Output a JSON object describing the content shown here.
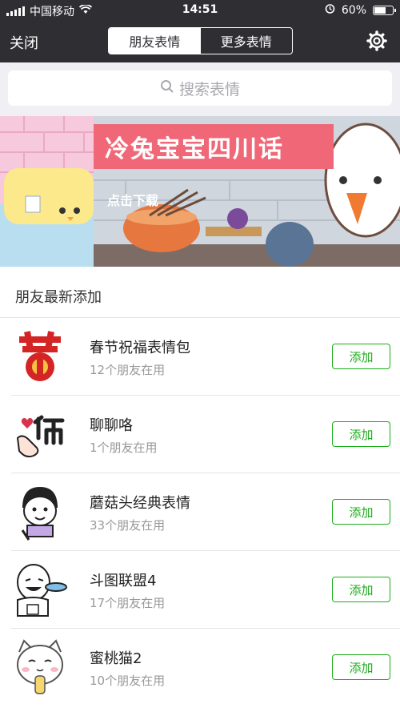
{
  "status_bar": {
    "carrier": "中国移动",
    "time": "14:51",
    "battery": "60%"
  },
  "nav": {
    "close_label": "关闭",
    "tabs": [
      {
        "label": "朋友表情",
        "active": true
      },
      {
        "label": "更多表情",
        "active": false
      }
    ]
  },
  "search": {
    "placeholder": "搜索表情"
  },
  "banner": {
    "title": "冷兔宝宝四川话",
    "cta": "点击下载"
  },
  "section": {
    "title": "朋友最新添加"
  },
  "items": [
    {
      "name": "春节祝福表情包",
      "count": "12个朋友在用",
      "add_label": "添加"
    },
    {
      "name": "聊聊咯",
      "count": "1个朋友在用",
      "add_label": "添加"
    },
    {
      "name": "蘑菇头经典表情",
      "count": "33个朋友在用",
      "add_label": "添加"
    },
    {
      "name": "斗图联盟4",
      "count": "17个朋友在用",
      "add_label": "添加"
    },
    {
      "name": "蜜桃猫2",
      "count": "10个朋友在用",
      "add_label": "添加"
    }
  ],
  "colors": {
    "nav_bg": "#2e2e33",
    "accent_green": "#1aad19",
    "banner_red": "#f06877"
  }
}
